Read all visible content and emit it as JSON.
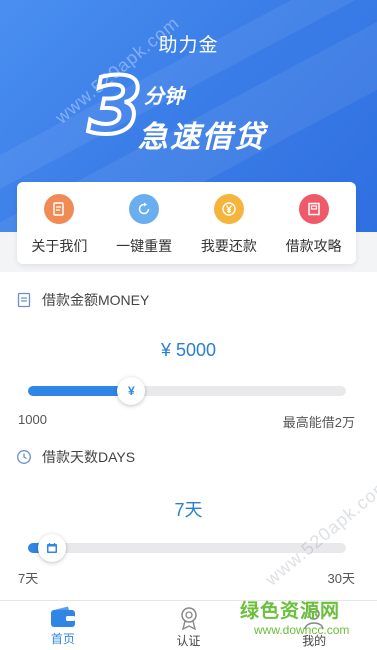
{
  "header": {
    "title": "助力金",
    "slogan_num": "3",
    "slogan_unit": "分钟",
    "slogan_text": "急速借贷"
  },
  "menu": [
    {
      "label": "关于我们",
      "icon": "document-icon",
      "color": "#f08b55"
    },
    {
      "label": "一键重置",
      "icon": "refresh-icon",
      "color": "#6aaef0"
    },
    {
      "label": "我要还款",
      "icon": "yen-coin-icon",
      "color": "#f5b43c"
    },
    {
      "label": "借款攻略",
      "icon": "book-icon",
      "color": "#ef5a6a"
    }
  ],
  "loan_amount": {
    "label": "借款金额MONEY",
    "value": "¥ 5000",
    "min_label": "1000",
    "max_label": "最高能借2万",
    "slider_fraction": 0.27
  },
  "loan_days": {
    "label": "借款天数DAYS",
    "value": "7天",
    "min_label": "7天",
    "max_label": "30天",
    "slider_fraction": 0.0
  },
  "tabs": [
    {
      "label": "首页",
      "icon": "wallet-icon",
      "active": true
    },
    {
      "label": "认证",
      "icon": "badge-icon",
      "active": false
    },
    {
      "label": "我的",
      "icon": "user-icon",
      "active": false
    }
  ],
  "watermarks": {
    "top": "www.520apk.com",
    "mid": "www.520apk.com",
    "brand_cn": "绿色资源网",
    "brand_url": "www.downcc.com"
  },
  "colors": {
    "primary": "#2f86e6",
    "hero": "#3b7ee8"
  }
}
